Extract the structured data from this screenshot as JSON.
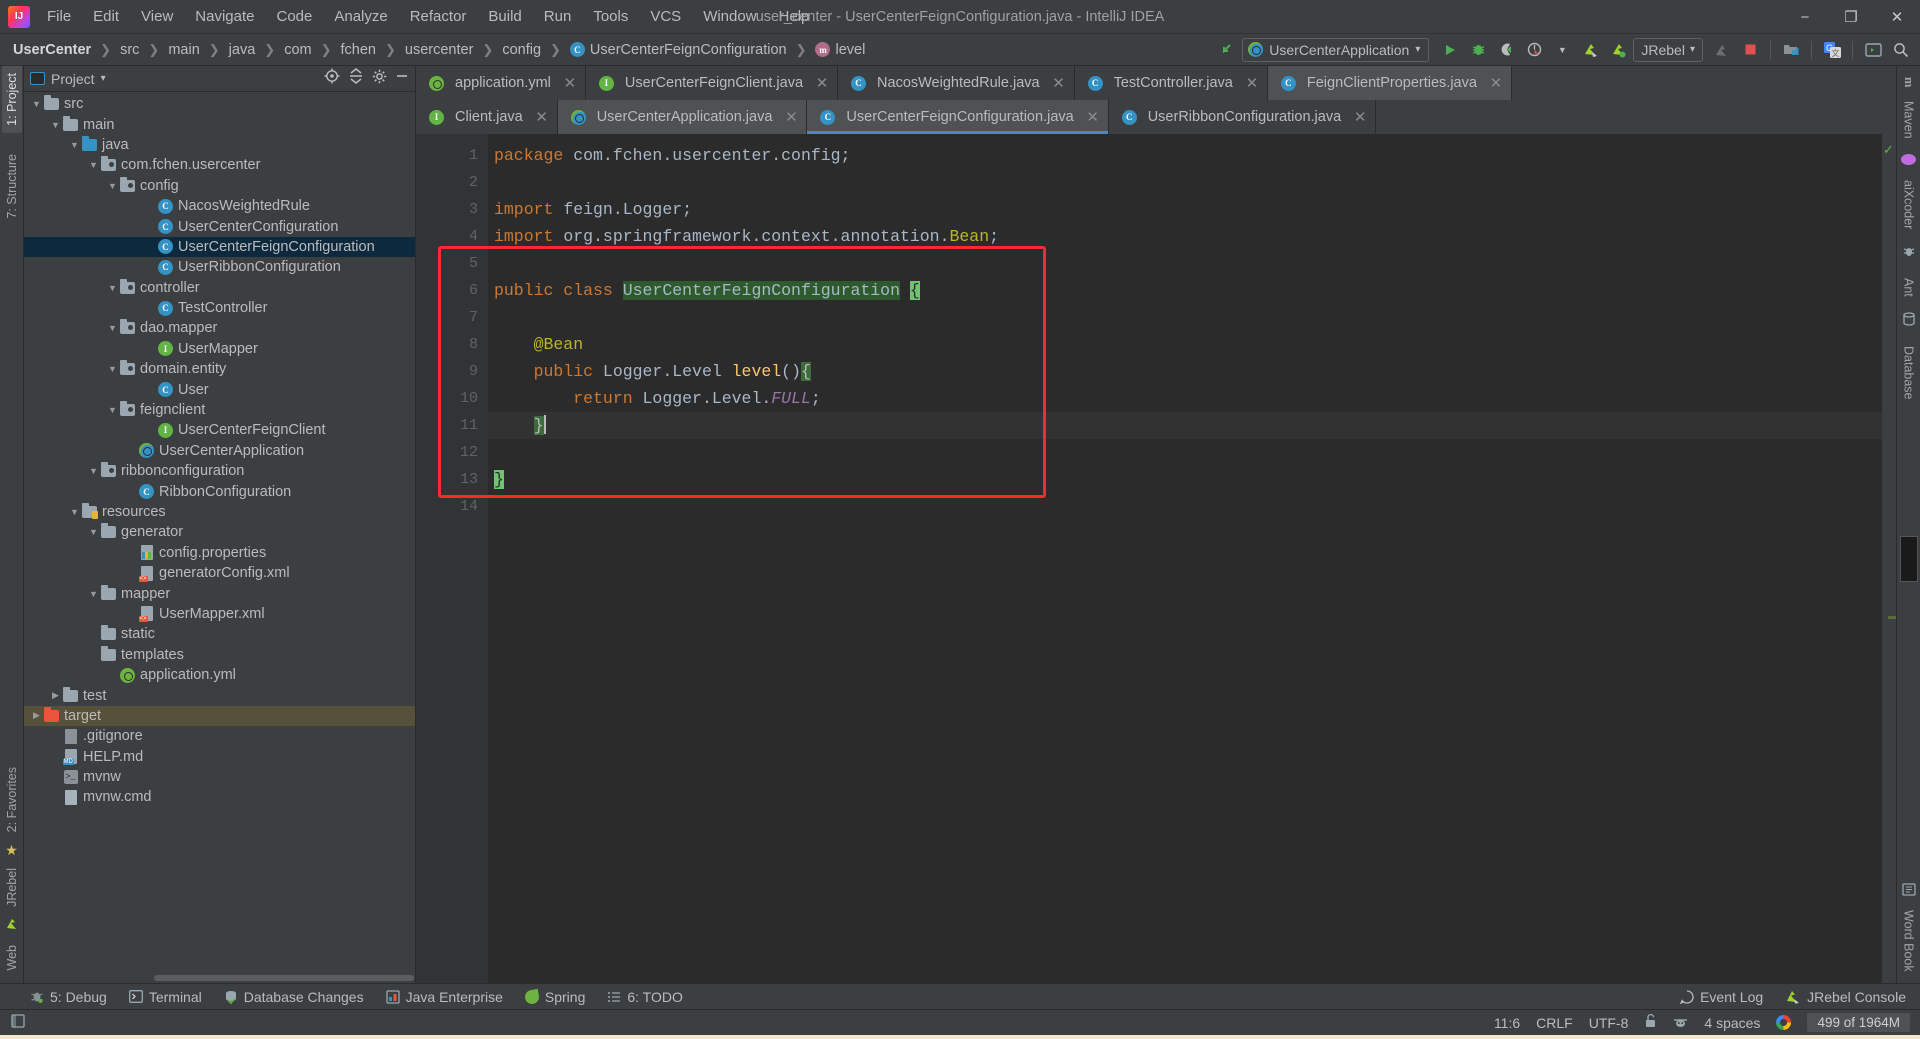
{
  "window": {
    "title": "user_center - UserCenterFeignConfiguration.java - IntelliJ IDEA",
    "minimize": "−",
    "maximize": "❐",
    "close": "✕"
  },
  "menubar": [
    {
      "label": "File"
    },
    {
      "label": "Edit"
    },
    {
      "label": "View"
    },
    {
      "label": "Navigate"
    },
    {
      "label": "Code"
    },
    {
      "label": "Analyze"
    },
    {
      "label": "Refactor"
    },
    {
      "label": "Build"
    },
    {
      "label": "Run"
    },
    {
      "label": "Tools"
    },
    {
      "label": "VCS"
    },
    {
      "label": "Window"
    },
    {
      "label": "Help"
    }
  ],
  "breadcrumbs": [
    {
      "label": "UserCenter",
      "icon": "",
      "bold": true
    },
    {
      "label": "src",
      "icon": ""
    },
    {
      "label": "main",
      "icon": ""
    },
    {
      "label": "java",
      "icon": ""
    },
    {
      "label": "com",
      "icon": ""
    },
    {
      "label": "fchen",
      "icon": ""
    },
    {
      "label": "usercenter",
      "icon": ""
    },
    {
      "label": "config",
      "icon": ""
    },
    {
      "label": "UserCenterFeignConfiguration",
      "icon": "class-icon"
    },
    {
      "label": "level",
      "icon": "method-icon"
    }
  ],
  "toolbar": {
    "run_config": "UserCenterApplication",
    "run_config_dropdown": "▾",
    "jrebel_label": "JRebel",
    "jrebel_dropdown": "▾",
    "icons": [
      "back-arrow-icon",
      "run-icon",
      "debug-icon",
      "run-coverage-icon",
      "profiler-icon",
      "jrebel-run-icon",
      "jrebel-debug-icon",
      "stop-icon",
      "update-project-icon",
      "translate-icon",
      "terminal-icon",
      "search-everywhere-icon"
    ]
  },
  "left_strip": [
    {
      "label": "1: Project",
      "active": true
    },
    {
      "label": "7: Structure",
      "active": false
    },
    {
      "label": "2: Favorites",
      "active": false
    },
    {
      "label": "JRebel",
      "active": false
    },
    {
      "label": "Web",
      "active": false
    }
  ],
  "right_strip": [
    {
      "label": "Maven"
    },
    {
      "label": "aiXcoder"
    },
    {
      "label": "Ant"
    },
    {
      "label": "Database"
    },
    {
      "label": "Word Book"
    }
  ],
  "project_panel": {
    "title": "Project",
    "dropdown": "▾",
    "actions": [
      "locate-icon",
      "collapse-all-icon",
      "settings-icon",
      "hide-icon"
    ],
    "tree": [
      {
        "label": "src",
        "indent": 1,
        "arrow": "▼",
        "icon": "folder-src",
        "state": ""
      },
      {
        "label": "main",
        "indent": 2,
        "arrow": "▼",
        "icon": "folder-gray",
        "state": ""
      },
      {
        "label": "java",
        "indent": 3,
        "arrow": "▼",
        "icon": "folder-blue",
        "state": ""
      },
      {
        "label": "com.fchen.usercenter",
        "indent": 4,
        "arrow": "▼",
        "icon": "folder-package",
        "state": ""
      },
      {
        "label": "config",
        "indent": 5,
        "arrow": "▼",
        "icon": "folder-package",
        "state": ""
      },
      {
        "label": "NacosWeightedRule",
        "indent": 7,
        "arrow": "",
        "icon": "class-icon",
        "state": ""
      },
      {
        "label": "UserCenterConfiguration",
        "indent": 7,
        "arrow": "",
        "icon": "class-icon",
        "state": ""
      },
      {
        "label": "UserCenterFeignConfiguration",
        "indent": 7,
        "arrow": "",
        "icon": "class-icon",
        "state": "selected"
      },
      {
        "label": "UserRibbonConfiguration",
        "indent": 7,
        "arrow": "",
        "icon": "class-icon",
        "state": ""
      },
      {
        "label": "controller",
        "indent": 5,
        "arrow": "▼",
        "icon": "folder-package",
        "state": ""
      },
      {
        "label": "TestController",
        "indent": 7,
        "arrow": "",
        "icon": "class-icon",
        "state": ""
      },
      {
        "label": "dao.mapper",
        "indent": 5,
        "arrow": "▼",
        "icon": "folder-package",
        "state": ""
      },
      {
        "label": "UserMapper",
        "indent": 7,
        "arrow": "",
        "icon": "interface-icon",
        "state": ""
      },
      {
        "label": "domain.entity",
        "indent": 5,
        "arrow": "▼",
        "icon": "folder-package",
        "state": ""
      },
      {
        "label": "User",
        "indent": 7,
        "arrow": "",
        "icon": "class-icon",
        "state": ""
      },
      {
        "label": "feignclient",
        "indent": 5,
        "arrow": "▼",
        "icon": "folder-package",
        "state": ""
      },
      {
        "label": "UserCenterFeignClient",
        "indent": 7,
        "arrow": "",
        "icon": "interface-icon",
        "state": ""
      },
      {
        "label": "UserCenterApplication",
        "indent": 6,
        "arrow": "",
        "icon": "spring-boot-icon",
        "state": ""
      },
      {
        "label": "ribbonconfiguration",
        "indent": 4,
        "arrow": "▼",
        "icon": "folder-package",
        "state": ""
      },
      {
        "label": "RibbonConfiguration",
        "indent": 6,
        "arrow": "",
        "icon": "class-icon",
        "state": ""
      },
      {
        "label": "resources",
        "indent": 3,
        "arrow": "▼",
        "icon": "folder-resources",
        "state": ""
      },
      {
        "label": "generator",
        "indent": 4,
        "arrow": "▼",
        "icon": "folder-gray",
        "state": ""
      },
      {
        "label": "config.properties",
        "indent": 6,
        "arrow": "",
        "icon": "properties-icon",
        "state": ""
      },
      {
        "label": "generatorConfig.xml",
        "indent": 6,
        "arrow": "",
        "icon": "xml-icon",
        "state": ""
      },
      {
        "label": "mapper",
        "indent": 4,
        "arrow": "▼",
        "icon": "folder-gray",
        "state": ""
      },
      {
        "label": "UserMapper.xml",
        "indent": 6,
        "arrow": "",
        "icon": "xml-icon",
        "state": ""
      },
      {
        "label": "static",
        "indent": 4,
        "arrow": "",
        "icon": "folder-gray",
        "state": ""
      },
      {
        "label": "templates",
        "indent": 4,
        "arrow": "",
        "icon": "folder-gray",
        "state": ""
      },
      {
        "label": "application.yml",
        "indent": 5,
        "arrow": "",
        "icon": "spring-yml-icon",
        "state": ""
      },
      {
        "label": "test",
        "indent": 2,
        "arrow": "▶",
        "icon": "folder-gray",
        "state": ""
      },
      {
        "label": "target",
        "indent": 1,
        "arrow": "▶",
        "icon": "folder-orange",
        "state": "target-hl"
      },
      {
        "label": ".gitignore",
        "indent": 2,
        "arrow": "",
        "icon": "gitignore-icon",
        "state": ""
      },
      {
        "label": "HELP.md",
        "indent": 2,
        "arrow": "",
        "icon": "md-icon",
        "state": ""
      },
      {
        "label": "mvnw",
        "indent": 2,
        "arrow": "",
        "icon": "script-icon",
        "state": ""
      },
      {
        "label": "mvnw.cmd",
        "indent": 2,
        "arrow": "",
        "icon": "cmd-icon",
        "state": ""
      }
    ]
  },
  "editor": {
    "tabs_row1": [
      {
        "label": "application.yml",
        "icon": "spring-yml-icon",
        "state": "",
        "close": "✕"
      },
      {
        "label": "UserCenterFeignClient.java",
        "icon": "interface-icon",
        "state": "",
        "close": "✕"
      },
      {
        "label": "NacosWeightedRule.java",
        "icon": "class-icon",
        "state": "",
        "close": "✕"
      },
      {
        "label": "TestController.java",
        "icon": "class-icon",
        "state": "",
        "close": "✕"
      },
      {
        "label": "FeignClientProperties.java",
        "icon": "class-readonly-icon",
        "state": "active",
        "close": "✕"
      }
    ],
    "tabs_row2": [
      {
        "label": "Client.java",
        "icon": "interface-icon",
        "state": "",
        "close": "✕"
      },
      {
        "label": "UserCenterApplication.java",
        "icon": "spring-boot-icon",
        "state": "active",
        "close": "✕"
      },
      {
        "label": "UserCenterFeignConfiguration.java",
        "icon": "class-icon",
        "state": "focused",
        "close": "✕"
      },
      {
        "label": "UserRibbonConfiguration.java",
        "icon": "class-icon",
        "state": "",
        "close": "✕"
      }
    ],
    "line_numbers": [
      "1",
      "2",
      "3",
      "4",
      "5",
      "6",
      "7",
      "8",
      "9",
      "10",
      "11",
      "12",
      "13",
      "14"
    ],
    "code_lines": [
      {
        "n": 1,
        "segments": [
          {
            "t": "package ",
            "c": "kw"
          },
          {
            "t": "com.fchen.usercenter.config;",
            "c": "plain"
          }
        ]
      },
      {
        "n": 2,
        "segments": []
      },
      {
        "n": 3,
        "segments": [
          {
            "t": "import ",
            "c": "kw"
          },
          {
            "t": "feign.Logger;",
            "c": "plain"
          }
        ]
      },
      {
        "n": 4,
        "segments": [
          {
            "t": "import ",
            "c": "kw"
          },
          {
            "t": "org.springframework.context.annotation.",
            "c": "plain"
          },
          {
            "t": "Bean",
            "c": "ann"
          },
          {
            "t": ";",
            "c": "plain"
          }
        ]
      },
      {
        "n": 5,
        "segments": []
      },
      {
        "n": 6,
        "segments": [
          {
            "t": "public class ",
            "c": "kw"
          },
          {
            "t": "UserCenterFeignConfiguration",
            "c": "hl-green"
          },
          {
            "t": " ",
            "c": "plain"
          },
          {
            "t": "{",
            "c": "hl-mint"
          }
        ]
      },
      {
        "n": 7,
        "segments": []
      },
      {
        "n": 8,
        "segments": [
          {
            "t": "    @Bean",
            "c": "ann"
          }
        ]
      },
      {
        "n": 9,
        "segments": [
          {
            "t": "    public ",
            "c": "kw"
          },
          {
            "t": "Logger.Level ",
            "c": "plain"
          },
          {
            "t": "level",
            "c": "mth"
          },
          {
            "t": "()",
            "c": "plain"
          },
          {
            "t": "{",
            "c": "hl-brace"
          }
        ]
      },
      {
        "n": 10,
        "segments": [
          {
            "t": "        return ",
            "c": "kw"
          },
          {
            "t": "Logger.Level.",
            "c": "plain"
          },
          {
            "t": "FULL",
            "c": "stat"
          },
          {
            "t": ";",
            "c": "plain"
          }
        ]
      },
      {
        "n": 11,
        "segments": [
          {
            "t": "    ",
            "c": "plain"
          },
          {
            "t": "}",
            "c": "hl-brace"
          }
        ],
        "current": true
      },
      {
        "n": 12,
        "segments": []
      },
      {
        "n": 13,
        "segments": [
          {
            "t": "}",
            "c": "hl-mint"
          }
        ]
      },
      {
        "n": 14,
        "segments": []
      }
    ],
    "annotation_highlight": "red-rectangle-overlay"
  },
  "bottom_bar": {
    "left": [
      {
        "label": "5: Debug",
        "icon": "debug-icon"
      },
      {
        "label": "Terminal",
        "icon": "terminal-icon"
      },
      {
        "label": "Database Changes",
        "icon": "database-changes-icon"
      },
      {
        "label": "Java Enterprise",
        "icon": "java-enterprise-icon"
      },
      {
        "label": "Spring",
        "icon": "spring-icon"
      },
      {
        "label": "6: TODO",
        "icon": "todo-icon"
      }
    ],
    "right": [
      {
        "label": "Event Log",
        "icon": "event-log-icon"
      },
      {
        "label": "JRebel Console",
        "icon": "jrebel-icon"
      }
    ]
  },
  "status_bar": {
    "caret": "11:6",
    "line_separator": "CRLF",
    "encoding": "UTF-8",
    "lock": "unlocked-icon",
    "inspector": "inspection-icon",
    "indent": "4 spaces",
    "google": "google-icon",
    "memory": "499 of 1964M"
  },
  "colors": {
    "accent": "#4a88c7",
    "annotation_red": "#fb2a2a",
    "selection": "#0d293e",
    "editor_bg": "#2b2b2b",
    "panel_bg": "#3c3f41"
  }
}
